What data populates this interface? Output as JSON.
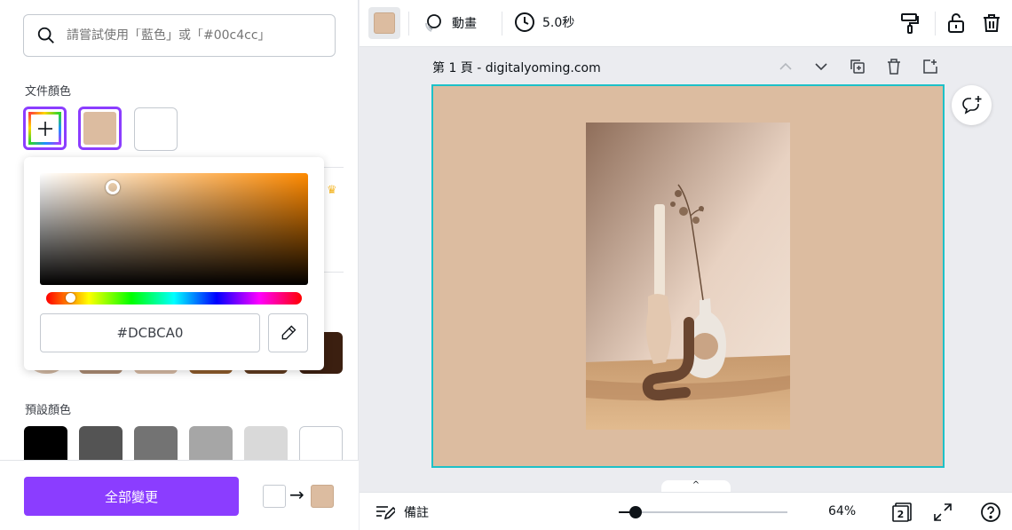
{
  "search": {
    "placeholder": "請嘗試使用「藍色」或「#00c4cc」",
    "icon": "search-icon"
  },
  "document_colors": {
    "label": "文件顏色",
    "add_icon": "plus-icon",
    "swatches": [
      "#dcbca0",
      "#ffffff"
    ]
  },
  "picker": {
    "hex_value": "#DCBCA0",
    "eyedropper_icon": "eyedropper-icon",
    "hue_value": 0.08,
    "saturation": 0.25,
    "brightness": 0.91
  },
  "premium_icon": "crown-icon",
  "photo_colors": [
    "#a98a72",
    "#d3b7a1",
    "#8b5a2b",
    "#5e3a1f",
    "#3b1f10"
  ],
  "preset_colors": {
    "label": "預設顏色",
    "swatches": [
      "#000000",
      "#545454",
      "#737373",
      "#a6a6a6",
      "#d9d9d9",
      "#ffffff"
    ]
  },
  "apply_button": {
    "label": "全部變更"
  },
  "replace_preview": {
    "from": "#ffffff",
    "to": "#dcbca0",
    "arrow": "→"
  },
  "toolbar": {
    "color_chip": "#dcbca0",
    "animate_label": "動畫",
    "duration_label": "5.0秒",
    "icons": [
      "format-painter-icon",
      "lock-icon",
      "trash-icon"
    ]
  },
  "page": {
    "title": "第 1 頁 - digitalyoming.com",
    "controls": [
      "chevron-up-icon",
      "chevron-down-icon",
      "duplicate-icon",
      "trash-icon",
      "add-page-icon"
    ],
    "background": "#dcbca0",
    "selection_color": "#1dc1c8"
  },
  "comment_icon": "add-comment-icon",
  "footer": {
    "collapse_icon": "^",
    "notes_label": "備註",
    "zoom_value": "64%",
    "zoom_fraction": 0.1,
    "page_count": "2",
    "icons": [
      "notes-icon",
      "pages-icon",
      "fullscreen-icon",
      "help-icon"
    ]
  }
}
